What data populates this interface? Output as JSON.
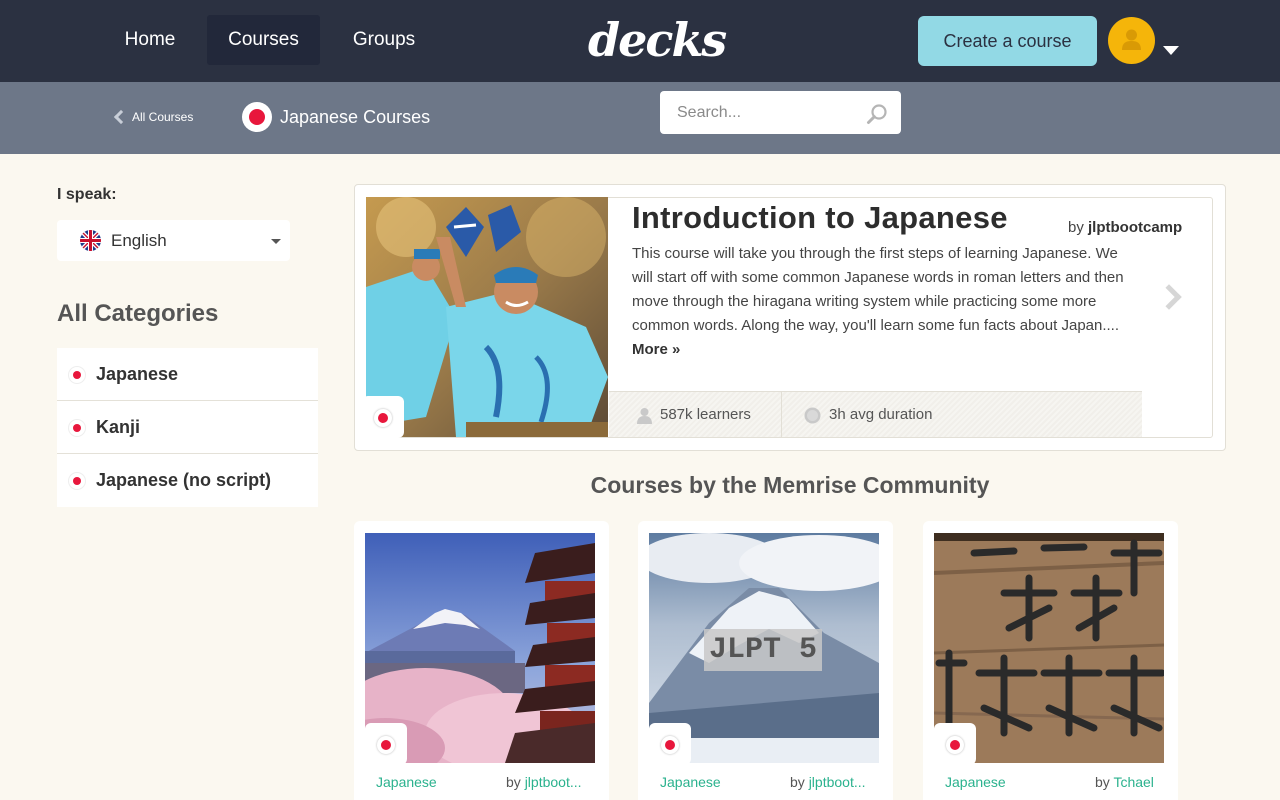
{
  "nav": {
    "items": [
      {
        "label": "Home"
      },
      {
        "label": "Courses"
      },
      {
        "label": "Groups"
      }
    ],
    "logo": "decks",
    "create_label": "Create a course"
  },
  "subbar": {
    "back_label": "All Courses",
    "language_label": "Japanese Courses",
    "search_placeholder": "Search..."
  },
  "sidebar": {
    "speak_label": "I speak:",
    "speak_value": "English",
    "categories_title": "All Categories",
    "categories": [
      {
        "label": "Japanese"
      },
      {
        "label": "Kanji"
      },
      {
        "label": "Japanese (no script)"
      }
    ]
  },
  "featured": {
    "title": "Introduction to Japanese",
    "by_prefix": "by",
    "author": "jlptbootcamp",
    "description": "This course will take you through the first steps of learning Japanese. We will start off with some common Japanese words in roman letters and then move through the hiragana writing system while practicing some more common words. Along the way, you'll learn some fun facts about Japan....",
    "more_label": "More »",
    "learners": "587k learners",
    "duration": "3h avg duration"
  },
  "section_title": "Courses by the Memrise Community",
  "cards": [
    {
      "tag": "Japanese",
      "by_prefix": "by",
      "author": "jlptboot..."
    },
    {
      "tag": "Japanese",
      "by_prefix": "by",
      "author": "jlptboot...",
      "image_text": "JLPT 5"
    },
    {
      "tag": "Japanese",
      "by_prefix": "by",
      "author": "Tchael"
    }
  ],
  "colors": {
    "topbar": "#2b3141",
    "subbar": "#6d7788",
    "accent": "#92d9e5",
    "avatar": "#f5b50a",
    "link": "#2bb28e",
    "flag_red": "#e8173c",
    "background": "#fbf8f0"
  }
}
